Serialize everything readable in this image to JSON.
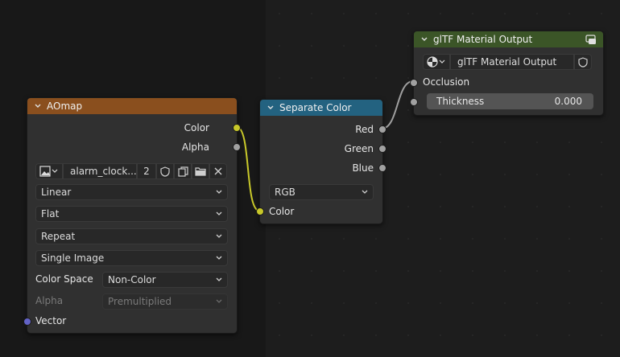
{
  "nodes": {
    "aomap": {
      "title": "AOmap",
      "header_color": "#8a4f1e",
      "outputs": {
        "color": "Color",
        "alpha": "Alpha"
      },
      "image": {
        "name": "alarm_clock...",
        "users": "2"
      },
      "interpolation": "Linear",
      "projection": "Flat",
      "extension": "Repeat",
      "source": "Single Image",
      "color_space_label": "Color Space",
      "color_space": "Non-Color",
      "alpha_label": "Alpha",
      "alpha_mode": "Premultiplied",
      "input_vector": "Vector"
    },
    "separate": {
      "title": "Separate Color",
      "header_color": "#236280",
      "outputs": {
        "red": "Red",
        "green": "Green",
        "blue": "Blue"
      },
      "mode": "RGB",
      "input_color": "Color"
    },
    "gltf": {
      "title": "glTF Material Output",
      "header_color": "#3b5527",
      "group_name": "glTF Material Output",
      "input_occlusion": "Occlusion",
      "thickness_label": "Thickness",
      "thickness_value": "0.000"
    }
  },
  "icons": [
    "chevron-down-icon",
    "image-icon",
    "shield-icon",
    "duplicate-icon",
    "folder-icon",
    "close-icon",
    "node-tree-icon",
    "render-icon"
  ],
  "colors": {
    "socket_color": "#c7c729",
    "socket_float": "#a1a1a1",
    "socket_vector": "#6363c7",
    "link_yellow": "#c9c92a",
    "link_grey": "#a0a0a0"
  }
}
